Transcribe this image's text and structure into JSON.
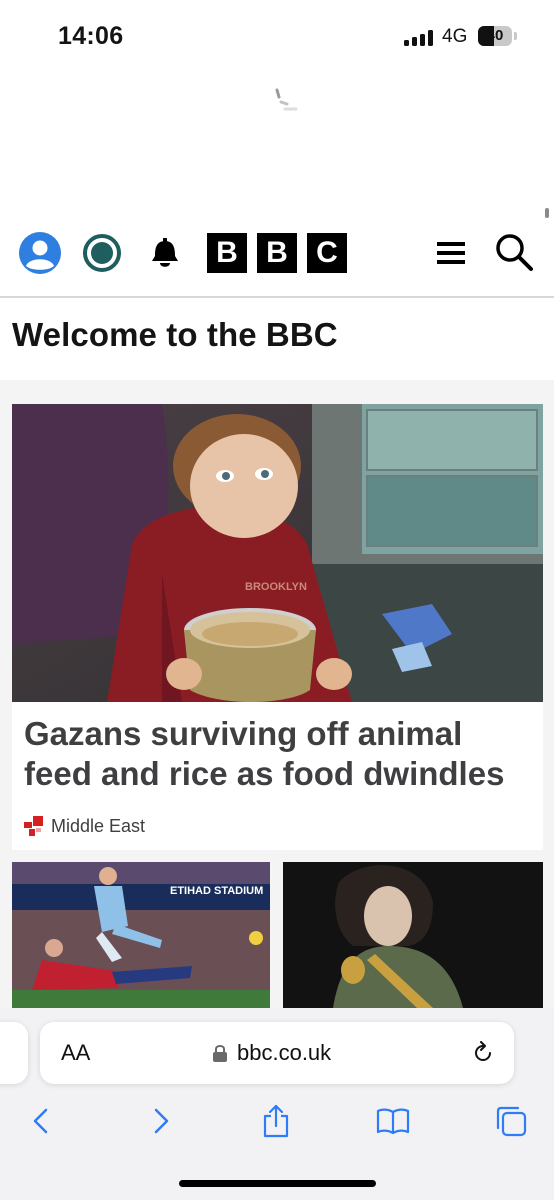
{
  "status_bar": {
    "time": "14:06",
    "network": "4G",
    "battery_level": "40"
  },
  "header": {
    "icons": [
      "account-icon",
      "live-radio-icon",
      "notifications-icon",
      "menu-icon",
      "search-icon"
    ],
    "logo_letters": [
      "B",
      "B",
      "C"
    ]
  },
  "page": {
    "welcome_title": "Welcome to the BBC"
  },
  "lead_story": {
    "headline": "Gazans surviving off animal feed and rice as food dwindles",
    "topic": "Middle East",
    "image": "photo-child-holding-tin-of-food",
    "shirt_text": "BROOKLYN"
  },
  "secondary_stories": [
    {
      "image": "photo-football-match",
      "stadium_sign": "ETIHAD STADIUM"
    },
    {
      "image": "photo-performer-on-stage"
    }
  ],
  "browser": {
    "text_size_label": "AA",
    "url": "bbc.co.uk",
    "toolbar": [
      "back-icon",
      "forward-icon",
      "share-icon",
      "bookmarks-icon",
      "tabs-icon"
    ]
  },
  "colors": {
    "brand_black": "#000000",
    "account_blue": "#2f7fe0",
    "live_teal": "#1f5e5e",
    "topic_red": "#d42020",
    "safari_blue": "#2f7cf6",
    "headline_grey": "#3f3f42"
  }
}
